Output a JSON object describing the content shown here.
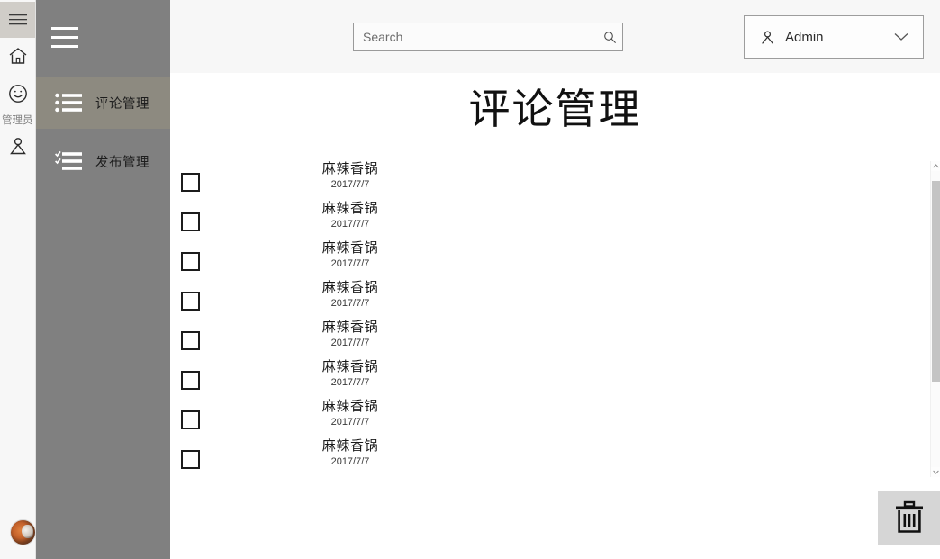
{
  "rail": {
    "hamburger_icon": "hamburger-icon",
    "home_icon": "home-icon",
    "smiley_icon": "smiley-icon",
    "person_icon": "person-icon",
    "label": "管理员",
    "avatar_alt": "user-avatar"
  },
  "flyout": {
    "toggle_icon": "hamburger-icon",
    "items": [
      {
        "label": "评论管理",
        "icon": "bulleted-list-icon",
        "selected": true
      },
      {
        "label": "发布管理",
        "icon": "checklist-icon",
        "selected": false
      }
    ]
  },
  "header": {
    "search": {
      "placeholder": "Search",
      "value": "",
      "icon": "search-icon"
    },
    "user": {
      "name": "Admin",
      "icon": "person-icon",
      "caret": "chevron-down-icon"
    }
  },
  "main": {
    "title": "评论管理",
    "list": [
      {
        "title": "麻辣香锅",
        "date": "2017/7/7",
        "checked": false
      },
      {
        "title": "麻辣香锅",
        "date": "2017/7/7",
        "checked": false
      },
      {
        "title": "麻辣香锅",
        "date": "2017/7/7",
        "checked": false
      },
      {
        "title": "麻辣香锅",
        "date": "2017/7/7",
        "checked": false
      },
      {
        "title": "麻辣香锅",
        "date": "2017/7/7",
        "checked": false
      },
      {
        "title": "麻辣香锅",
        "date": "2017/7/7",
        "checked": false
      },
      {
        "title": "麻辣香锅",
        "date": "2017/7/7",
        "checked": false
      },
      {
        "title": "麻辣香锅",
        "date": "2017/7/7",
        "checked": false
      }
    ],
    "scrollbar": {
      "up_icon": "chevron-up-icon",
      "down_icon": "chevron-down-icon"
    },
    "delete_button": {
      "icon": "trash-icon"
    }
  },
  "colors": {
    "flyout_bg": "#808080",
    "flyout_selected": "#8d8a80",
    "header_bg": "#f7f7f7",
    "rail_bg": "#f7f7f7",
    "delete_panel_bg": "#d6d6d6",
    "scrollbar_thumb": "#c4c4c4"
  }
}
